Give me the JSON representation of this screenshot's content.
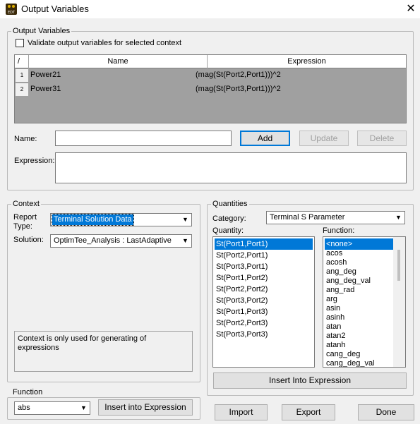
{
  "window": {
    "title": "Output Variables",
    "icon_text": "EDT"
  },
  "output_variables": {
    "group_label": "Output Variables",
    "validate_label": "Validate output variables for selected context",
    "columns": [
      "/",
      "Name",
      "Expression"
    ],
    "rows": [
      {
        "num": "1",
        "name": "Power21",
        "expression": "(mag(St(Port2,Port1)))^2"
      },
      {
        "num": "2",
        "name": "Power31",
        "expression": "(mag(St(Port3,Port1)))^2"
      }
    ],
    "name_label": "Name:",
    "expression_label": "Expression:",
    "name_value": "",
    "expression_value": "",
    "add_label": "Add",
    "update_label": "Update",
    "delete_label": "Delete"
  },
  "context": {
    "group_label": "Context",
    "report_type_label": "Report\nType:",
    "report_type_label_1": "Report",
    "report_type_label_2": "Type:",
    "report_type_value": "Terminal Solution Data",
    "solution_label": "Solution:",
    "solution_value": "OptimTee_Analysis : LastAdaptive",
    "info_text": "Context is only used for generating of expressions"
  },
  "quantities": {
    "group_label": "Quantities",
    "category_label": "Category:",
    "category_value": "Terminal S Parameter",
    "quantity_label": "Quantity:",
    "function_label": "Function:",
    "quantity_items": [
      "St(Port1,Port1)",
      "St(Port2,Port1)",
      "St(Port3,Port1)",
      "St(Port1,Port2)",
      "St(Port2,Port2)",
      "St(Port3,Port2)",
      "St(Port1,Port3)",
      "St(Port2,Port3)",
      "St(Port3,Port3)"
    ],
    "function_items": [
      "<none>",
      "acos",
      "acosh",
      "ang_deg",
      "ang_deg_val",
      "ang_rad",
      "arg",
      "asin",
      "asinh",
      "atan",
      "atan2",
      "atanh",
      "cang_deg",
      "cang_deg_val"
    ],
    "insert_label": "Insert Into Expression"
  },
  "function": {
    "group_label": "Function",
    "value": "abs",
    "insert_label": "Insert into Expression"
  },
  "footer": {
    "import_label": "Import",
    "export_label": "Export",
    "done_label": "Done"
  },
  "colors": {
    "selection": "#0078d7",
    "grid_bg": "#a0a0a0",
    "window_bg": "#f0f0f0"
  }
}
